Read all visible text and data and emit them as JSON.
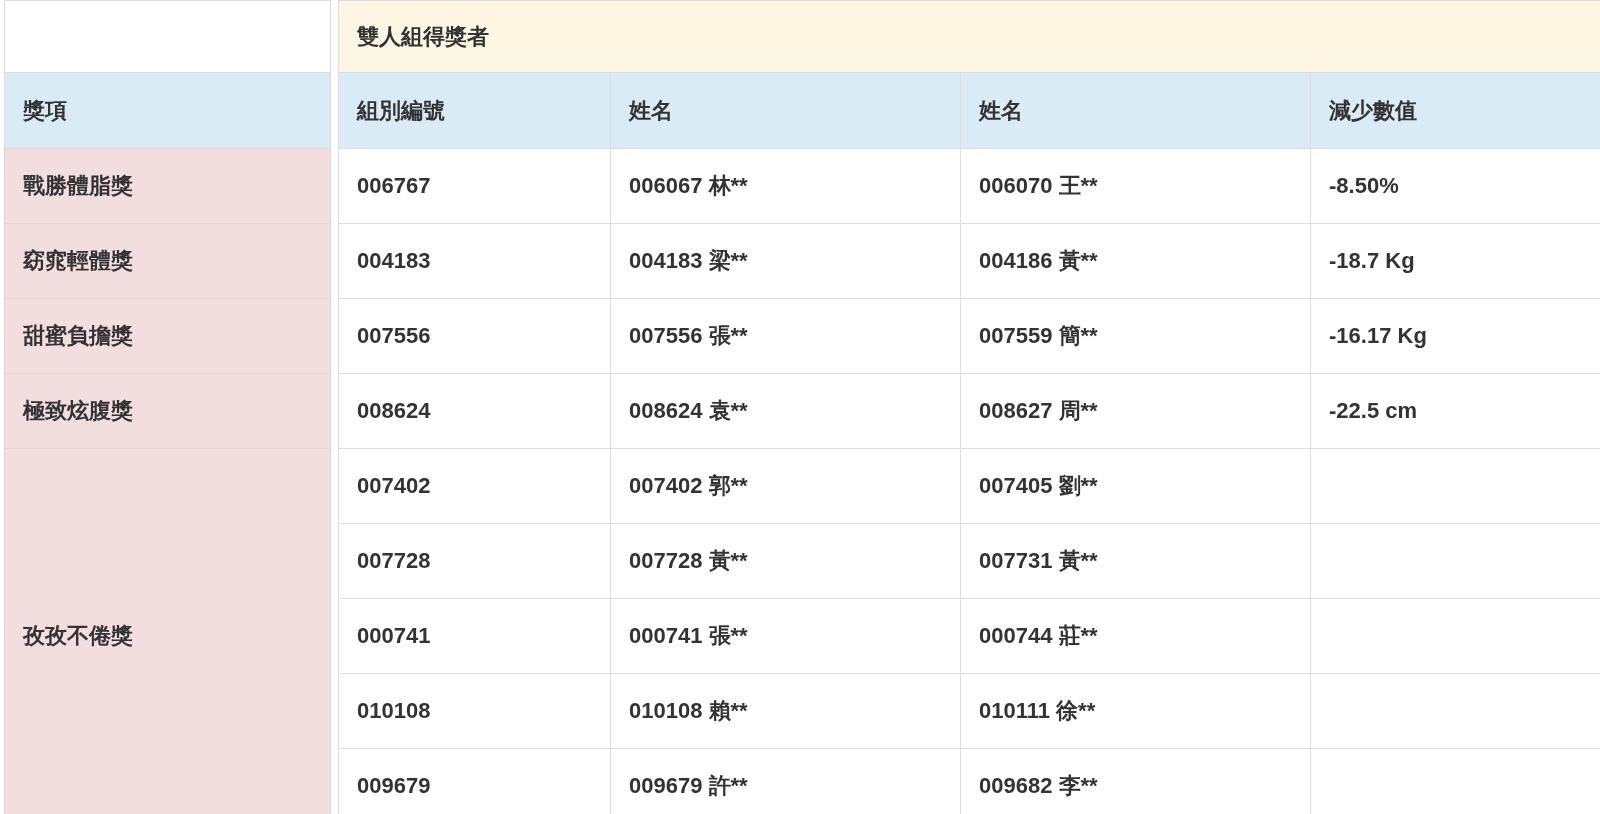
{
  "table": {
    "title": "雙人組得獎者",
    "award_heading": "獎項",
    "columns": [
      "組別編號",
      "姓名",
      "姓名",
      "減少數值"
    ],
    "awards": [
      {
        "name": "戰勝體脂獎",
        "rows": [
          {
            "group": "006767",
            "member_1": "006067 林**",
            "member_2": "006070 王**",
            "reduction": "-8.50%"
          }
        ]
      },
      {
        "name": "窈窕輕體獎",
        "rows": [
          {
            "group": "004183",
            "member_1": "004183 梁**",
            "member_2": "004186 黃**",
            "reduction": "-18.7 Kg"
          }
        ]
      },
      {
        "name": "甜蜜負擔獎",
        "rows": [
          {
            "group": "007556",
            "member_1": "007556 張**",
            "member_2": "007559 簡**",
            "reduction": "-16.17 Kg"
          }
        ]
      },
      {
        "name": "極致炫腹獎",
        "rows": [
          {
            "group": "008624",
            "member_1": "008624 袁**",
            "member_2": "008627 周**",
            "reduction": "-22.5 cm"
          }
        ]
      },
      {
        "name": "孜孜不倦獎",
        "rows": [
          {
            "group": "007402",
            "member_1": "007402 郭**",
            "member_2": "007405 劉**"
          },
          {
            "group": "007728",
            "member_1": "007728 黃**",
            "member_2": "007731 黃**"
          },
          {
            "group": "000741",
            "member_1": "000741 張**",
            "member_2": "000744 莊**"
          },
          {
            "group": "010108",
            "member_1": "010108 賴**",
            "member_2": "010111 徐**"
          },
          {
            "group": "009679",
            "member_1": "009679 許**",
            "member_2": "009682 李**"
          }
        ]
      }
    ]
  }
}
